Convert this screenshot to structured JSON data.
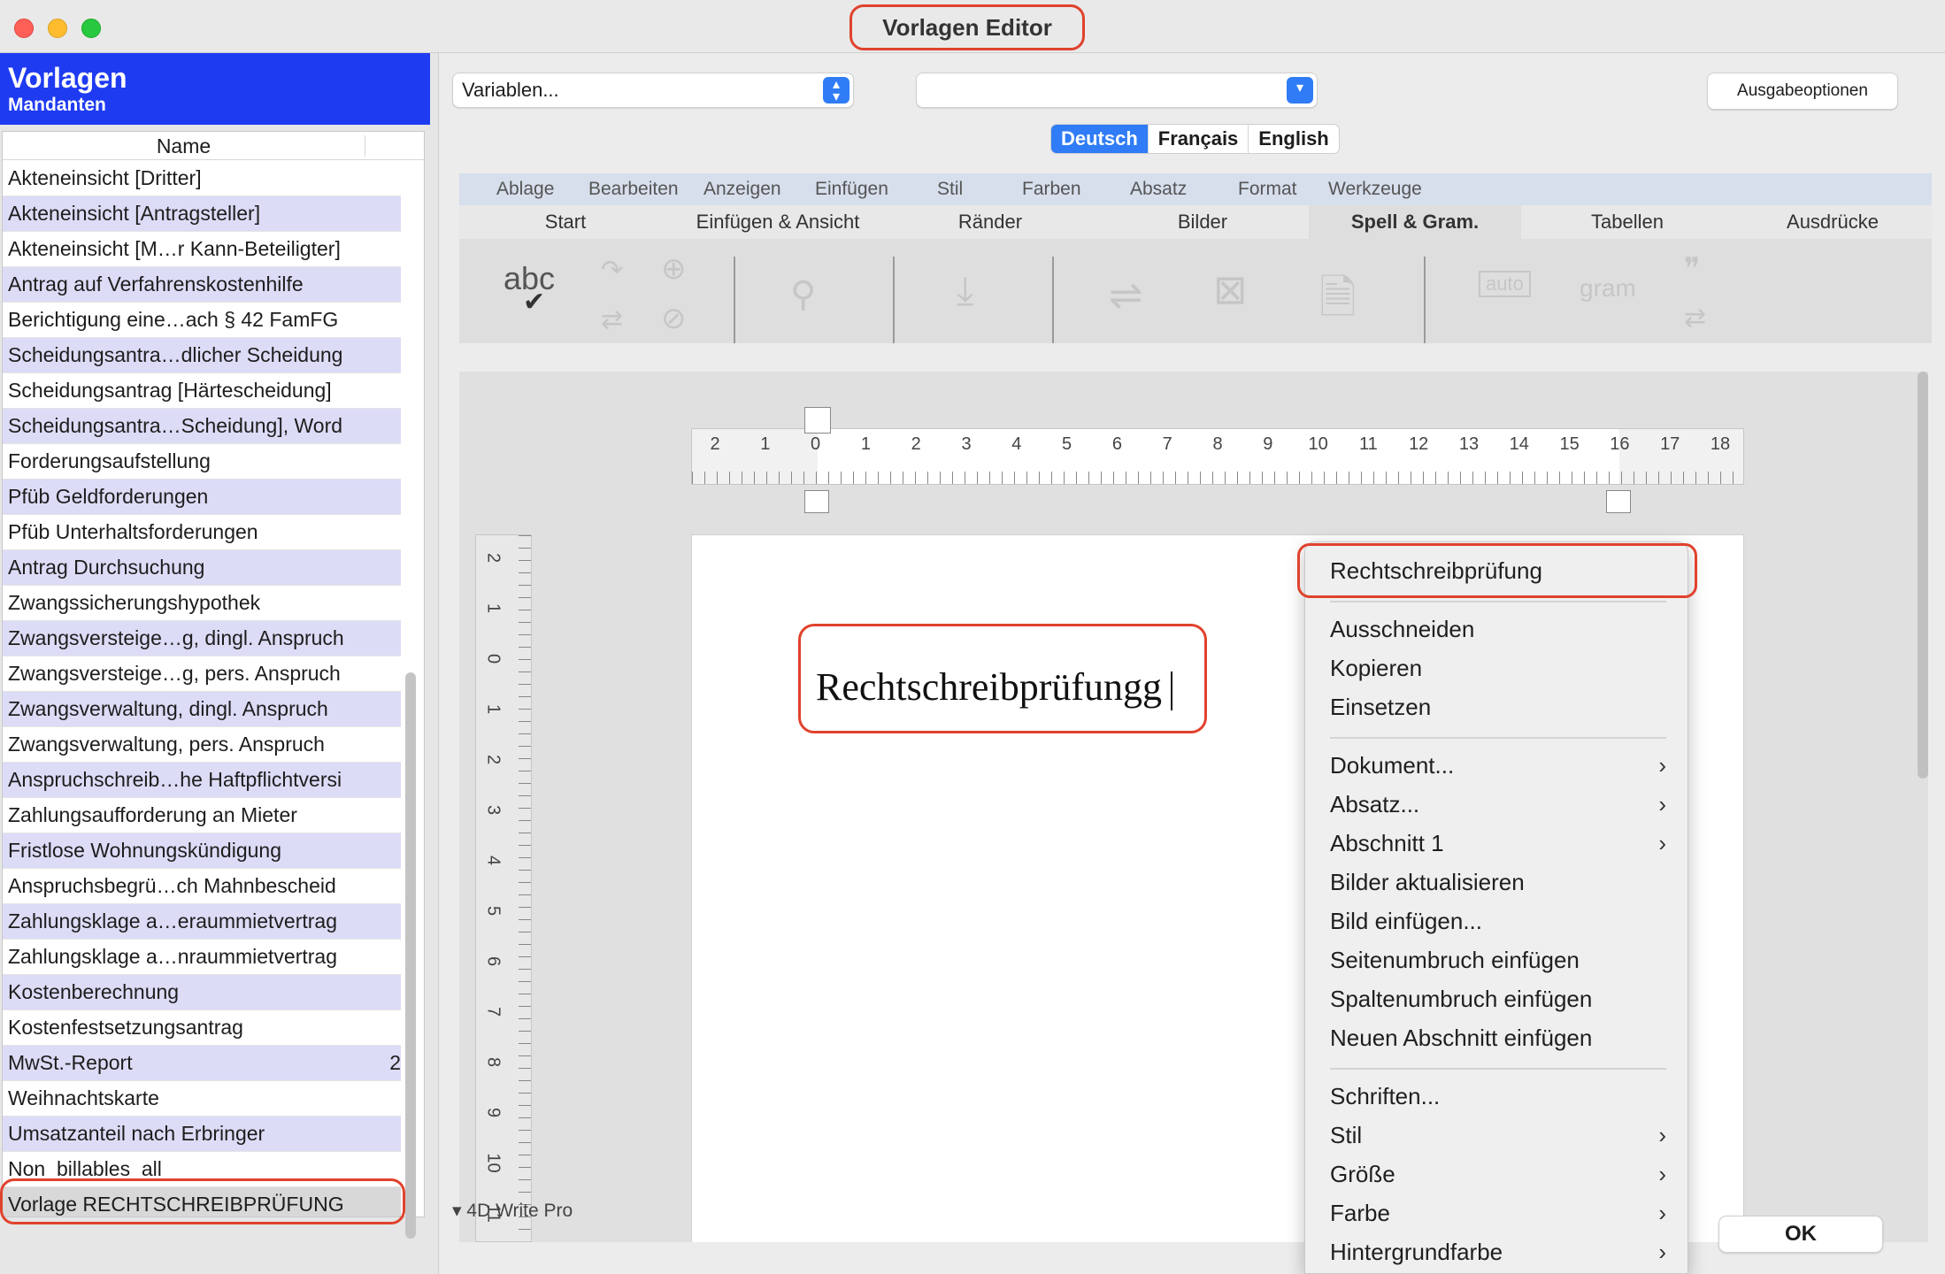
{
  "window": {
    "title": "Vorlagen Editor"
  },
  "left": {
    "title": "Vorlagen",
    "subtitle": "Mandanten",
    "column_name": "Name",
    "rows": [
      {
        "label": "Akteneinsicht [Dritter]",
        "count": ""
      },
      {
        "label": "Akteneinsicht [Antragsteller]",
        "count": ""
      },
      {
        "label": "Akteneinsicht [M…r Kann-Beteiligter]",
        "count": ""
      },
      {
        "label": "Antrag auf Verfahrenskostenhilfe",
        "count": ""
      },
      {
        "label": "Berichtigung eine…ach § 42 FamFG",
        "count": ""
      },
      {
        "label": "Scheidungsantra…dlicher Scheidung",
        "count": ""
      },
      {
        "label": "Scheidungsantrag [Härtescheidung]",
        "count": ""
      },
      {
        "label": "Scheidungsantra…Scheidung], Word",
        "count": ""
      },
      {
        "label": "Forderungsaufstellung",
        "count": ""
      },
      {
        "label": "Pfüb Geldforderungen",
        "count": ""
      },
      {
        "label": "Pfüb Unterhaltsforderungen",
        "count": ""
      },
      {
        "label": "Antrag Durchsuchung",
        "count": ""
      },
      {
        "label": "Zwangssicherungshypothek",
        "count": ""
      },
      {
        "label": "Zwangsversteige…g, dingl. Anspruch",
        "count": ""
      },
      {
        "label": "Zwangsversteige…g, pers. Anspruch",
        "count": ""
      },
      {
        "label": "Zwangsverwaltung, dingl. Anspruch",
        "count": ""
      },
      {
        "label": "Zwangsverwaltung, pers. Anspruch",
        "count": ""
      },
      {
        "label": "Anspruchschreib…he Haftpflichtversi",
        "count": ""
      },
      {
        "label": "Zahlungsaufforderung an Mieter",
        "count": ""
      },
      {
        "label": "Fristlose Wohnungskündigung",
        "count": ""
      },
      {
        "label": "Anspruchsbegrü…ch Mahnbescheid",
        "count": ""
      },
      {
        "label": "Zahlungsklage a…eraummietvertrag",
        "count": ""
      },
      {
        "label": "Zahlungsklage a…nraummietvertrag",
        "count": ""
      },
      {
        "label": "Kostenberechnung",
        "count": ""
      },
      {
        "label": "Kostenfestsetzungsantrag",
        "count": ""
      },
      {
        "label": "MwSt.-Report",
        "count": "2"
      },
      {
        "label": "Weihnachtskarte",
        "count": ""
      },
      {
        "label": "Umsatzanteil nach Erbringer",
        "count": ""
      },
      {
        "label": "Non_billables_all",
        "count": ""
      },
      {
        "label": "Vorlage RECHTSCHREIBPRÜFUNG",
        "count": ""
      }
    ],
    "add_icon": "+",
    "remove_icon": "−",
    "gear_icon": "⚙▾"
  },
  "toolbar": {
    "variables_value": "Variablen...",
    "second_popup_value": "",
    "output_options": "Ausgabeoptionen",
    "languages": [
      "Deutsch",
      "Français",
      "English"
    ],
    "selected_language": "Deutsch"
  },
  "menubar": [
    "Ablage",
    "Bearbeiten",
    "Anzeigen",
    "Einfügen",
    "Stil",
    "Farben",
    "Absatz",
    "Format",
    "Werkzeuge"
  ],
  "ribbon_tabs": [
    "Start",
    "Einfügen & Ansicht",
    "Ränder",
    "Bilder",
    "Spell & Gram.",
    "Tabellen",
    "Ausdrücke"
  ],
  "active_ribbon_tab": "Spell & Gram.",
  "ribbon_tools": {
    "spellcheck_label": "abc",
    "auto_label": "auto",
    "gram_label": "gram"
  },
  "ruler": {
    "h_left": [
      "2",
      "1"
    ],
    "h_main": [
      "0",
      "1",
      "2",
      "3",
      "4",
      "5",
      "6",
      "7",
      "8",
      "9",
      "10",
      "11",
      "12",
      "13",
      "14",
      "15",
      "16",
      "17",
      "18"
    ],
    "v": [
      "2",
      "1",
      "0",
      "1",
      "2",
      "3",
      "4",
      "5",
      "6",
      "7",
      "8",
      "9",
      "10",
      "11"
    ]
  },
  "document": {
    "text": "Rechtschreibprüfungg"
  },
  "footer": {
    "label": "4D Write Pro",
    "ok": "OK"
  },
  "context_menu": {
    "items": [
      {
        "label": "Rechtschreibprüfung",
        "submenu": false
      },
      {
        "label": "Ausschneiden",
        "submenu": false
      },
      {
        "label": "Kopieren",
        "submenu": false
      },
      {
        "label": "Einsetzen",
        "submenu": false
      },
      {
        "label": "Dokument...",
        "submenu": true
      },
      {
        "label": "Absatz...",
        "submenu": true
      },
      {
        "label": "Abschnitt 1",
        "submenu": true
      },
      {
        "label": "Bilder aktualisieren",
        "submenu": false
      },
      {
        "label": "Bild einfügen...",
        "submenu": false
      },
      {
        "label": "Seitenumbruch einfügen",
        "submenu": false
      },
      {
        "label": "Spaltenumbruch einfügen",
        "submenu": false
      },
      {
        "label": "Neuen Abschnitt einfügen",
        "submenu": false
      },
      {
        "label": "Schriften...",
        "submenu": false
      },
      {
        "label": "Stil",
        "submenu": true
      },
      {
        "label": "Größe",
        "submenu": true
      },
      {
        "label": "Farbe",
        "submenu": true
      },
      {
        "label": "Hintergrundfarbe",
        "submenu": true
      }
    ]
  },
  "colors": {
    "accent": "#2f7cf6",
    "header_blue": "#1f3bf2",
    "highlight_ring": "#e0422d",
    "row_alt": "#dcdcf7"
  }
}
